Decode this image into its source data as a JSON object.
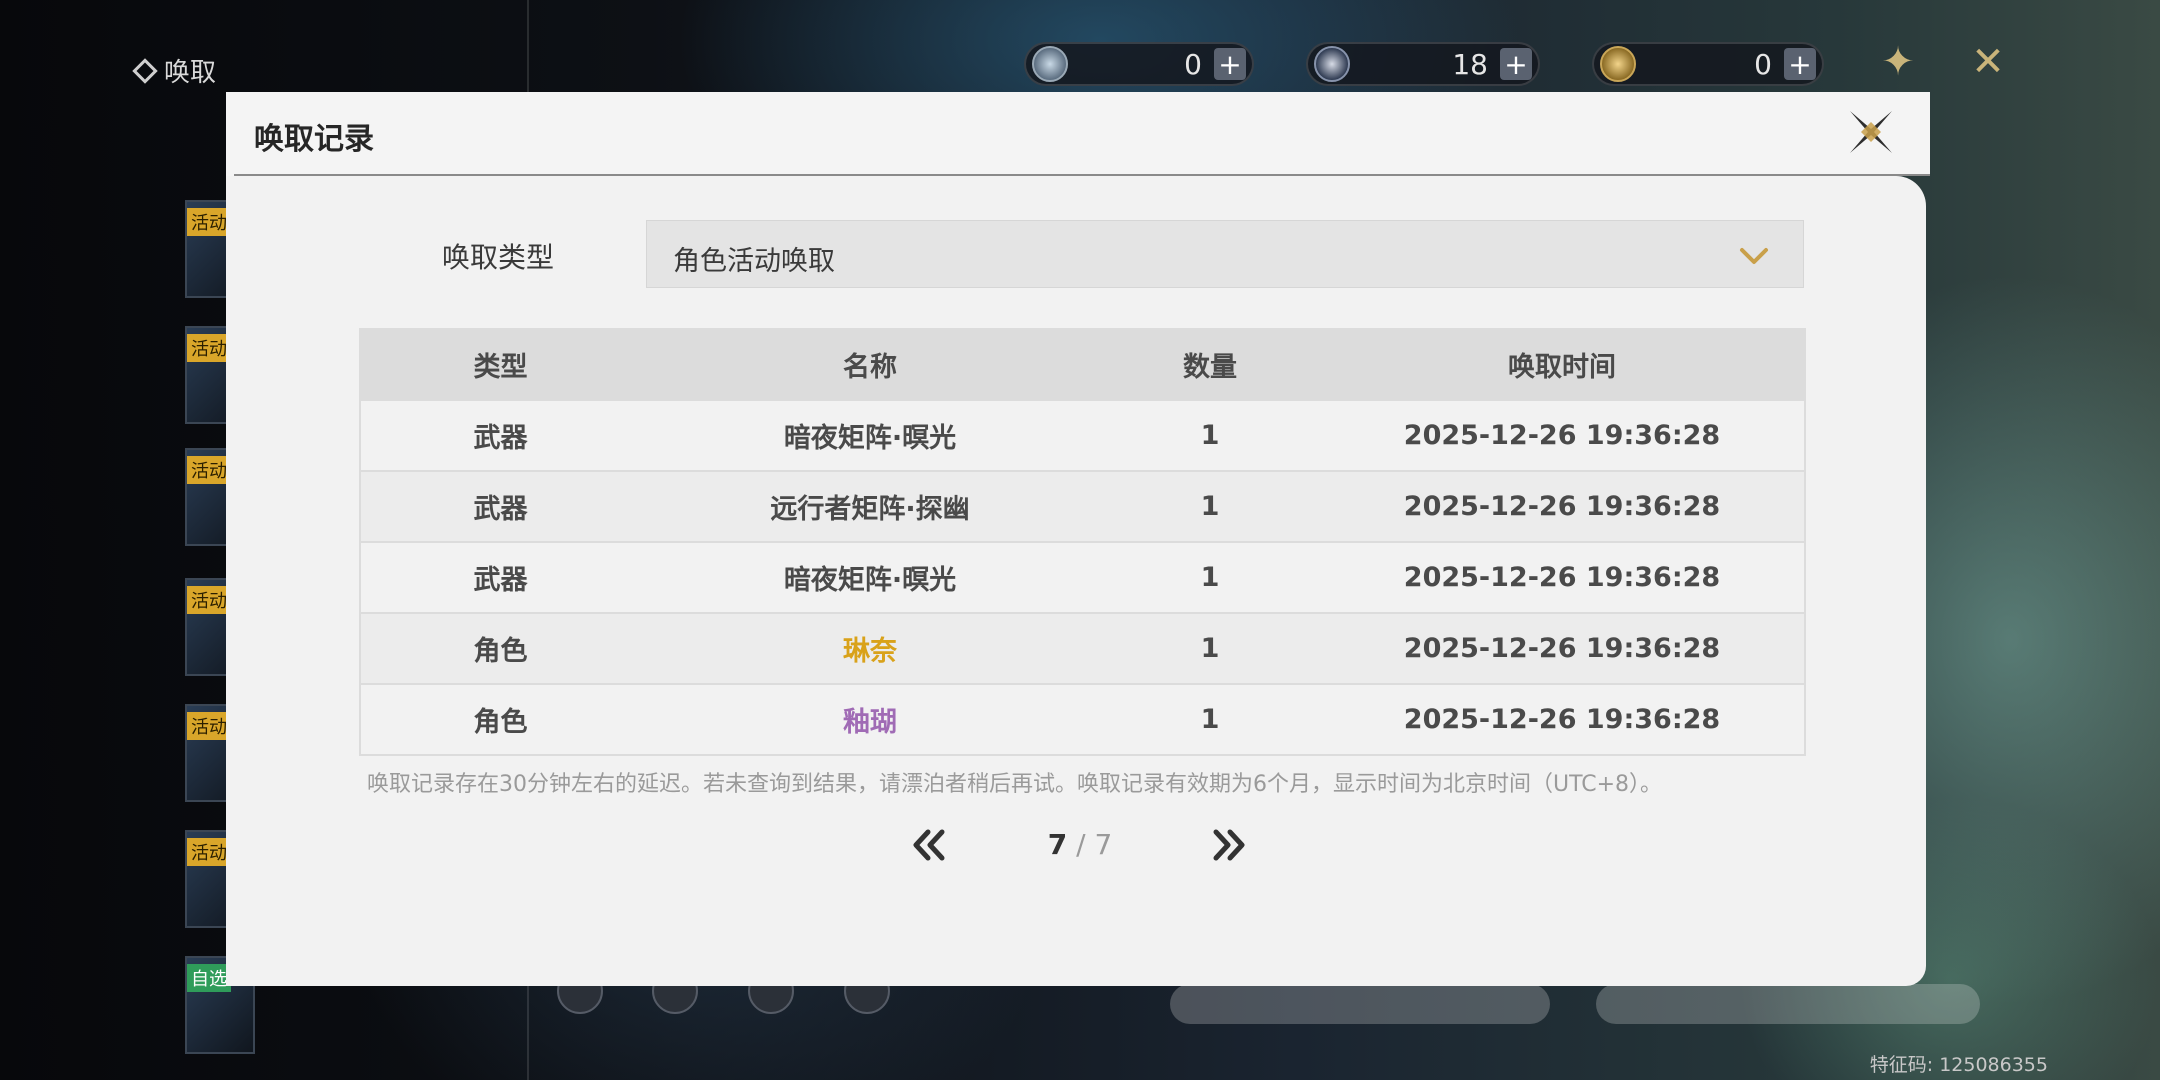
{
  "screen": {
    "section_title": "唤取",
    "id_label": "特征码: 125086355"
  },
  "currencies": [
    {
      "icon": "lunite-icon",
      "value": "0"
    },
    {
      "icon": "star-tide-icon",
      "value": "18"
    },
    {
      "icon": "astrite-coin-icon",
      "value": "0"
    }
  ],
  "side_banners": [
    {
      "tag": "活动"
    },
    {
      "tag": "活动"
    },
    {
      "tag": "活动"
    },
    {
      "tag": "活动"
    },
    {
      "tag": "活动"
    },
    {
      "tag": "活动"
    },
    {
      "tag": "自选"
    }
  ],
  "modal": {
    "title": "唤取记录",
    "filter_label": "唤取类型",
    "filter_value": "角色活动唤取",
    "columns": [
      "类型",
      "名称",
      "数量",
      "唤取时间"
    ],
    "rows": [
      {
        "type": "武器",
        "name": "暗夜矩阵·暝光",
        "qty": "1",
        "time": "2025-12-26 19:36:28",
        "rarity": "normal"
      },
      {
        "type": "武器",
        "name": "远行者矩阵·探幽",
        "qty": "1",
        "time": "2025-12-26 19:36:28",
        "rarity": "normal"
      },
      {
        "type": "武器",
        "name": "暗夜矩阵·暝光",
        "qty": "1",
        "time": "2025-12-26 19:36:28",
        "rarity": "normal"
      },
      {
        "type": "角色",
        "name": "琳奈",
        "qty": "1",
        "time": "2025-12-26 19:36:28",
        "rarity": "five-star"
      },
      {
        "type": "角色",
        "name": "釉瑚",
        "qty": "1",
        "time": "2025-12-26 19:36:28",
        "rarity": "four-star"
      }
    ],
    "note": "唤取记录存在30分钟左右的延迟。若未查询到结果，请漂泊者稍后再试。唤取记录有效期为6个月，显示时间为北京时间（UTC+8）。",
    "page_current": "7",
    "page_sep": " / ",
    "page_total": "7"
  },
  "colors": {
    "five_star": "#d9a21a",
    "four_star": "#a06bb5",
    "accent": "#c9a04a"
  }
}
